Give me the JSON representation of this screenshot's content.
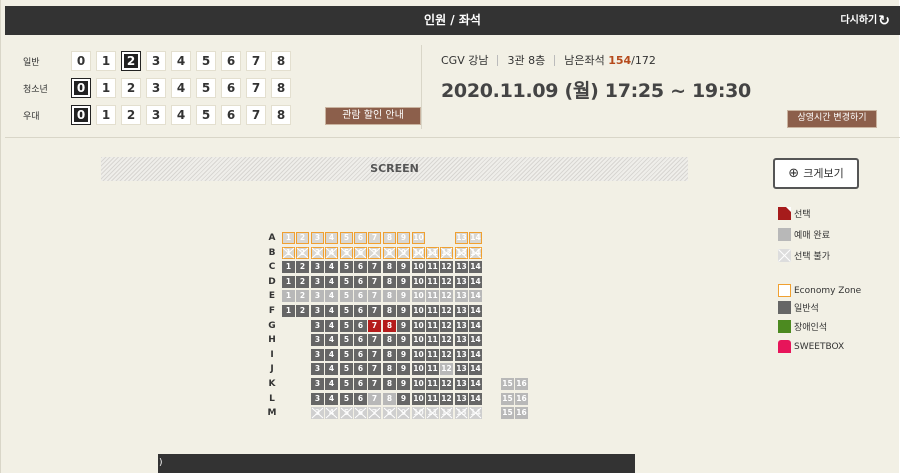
{
  "header": {
    "title": "인원 / 좌석",
    "refresh_label": "다시하기",
    "refresh_icon": "refresh-icon"
  },
  "counts": {
    "rows": [
      {
        "label": "일반",
        "selected": 2
      },
      {
        "label": "청소년",
        "selected": 0
      },
      {
        "label": "우대",
        "selected": 0
      }
    ],
    "numbers": [
      "0",
      "1",
      "2",
      "3",
      "4",
      "5",
      "6",
      "7",
      "8"
    ],
    "discount_label": "관람 할인 안내"
  },
  "theater": {
    "name": "CGV 강남",
    "hall": "3관 8층",
    "remaining_label": "남은좌석",
    "remaining": "154",
    "total": "/172",
    "datetime": "2020.11.09 (월) 17:25 ~ 19:30",
    "change_time_label": "상영시간 변경하기"
  },
  "screen_label": "SCREEN",
  "zoom_label": "크게보기",
  "legend": [
    {
      "key": "sel",
      "label": "선택"
    },
    {
      "key": "done",
      "label": "예매 완료"
    },
    {
      "key": "na",
      "label": "선택 불가"
    },
    {
      "key": "eco",
      "label": "Economy Zone"
    },
    {
      "key": "gen",
      "label": "일반석"
    },
    {
      "key": "dis",
      "label": "장애인석"
    },
    {
      "key": "sweet",
      "label": "SWEETBOX"
    }
  ],
  "colors": {
    "header": "#333333",
    "accent_button": "#8c5f4b",
    "selected_seat": "#b51c1c",
    "general_seat": "#666666",
    "economy_border": "#f0a030",
    "disabled_seat": "#4c8a20",
    "sweetbox": "#e7155a",
    "remaining_count": "#b54a1c"
  },
  "seats": {
    "rows": [
      {
        "label": "A",
        "seats": [
          [
            "1",
            "eco"
          ],
          [
            "2",
            "eco"
          ],
          [
            "3",
            "eco"
          ],
          [
            "4",
            "eco"
          ],
          [
            "5",
            "eco"
          ],
          [
            "6",
            "eco"
          ],
          [
            "7",
            "eco"
          ],
          [
            "8",
            "eco"
          ],
          [
            "9",
            "eco"
          ],
          [
            "10",
            "eco"
          ],
          null,
          null,
          [
            "13",
            "eco"
          ],
          [
            "14",
            "eco"
          ]
        ]
      },
      {
        "label": "B",
        "seats": [
          [
            "1",
            "ecox"
          ],
          [
            "2",
            "ecox"
          ],
          [
            "3",
            "ecox"
          ],
          [
            "4",
            "ecox"
          ],
          [
            "5",
            "ecox"
          ],
          [
            "6",
            "ecox"
          ],
          [
            "7",
            "ecox"
          ],
          [
            "8",
            "ecox"
          ],
          [
            "9",
            "ecox"
          ],
          [
            "10",
            "ecox"
          ],
          [
            "11",
            "ecox"
          ],
          [
            "12",
            "ecox"
          ],
          [
            "13",
            "ecox"
          ],
          [
            "14",
            "ecox"
          ]
        ]
      },
      {
        "label": "C",
        "seats": [
          [
            "1",
            "gen"
          ],
          [
            "2",
            "gen"
          ],
          [
            "3",
            "gen"
          ],
          [
            "4",
            "gen"
          ],
          [
            "5",
            "gen"
          ],
          [
            "6",
            "gen"
          ],
          [
            "7",
            "gen"
          ],
          [
            "8",
            "gen"
          ],
          [
            "9",
            "gen"
          ],
          [
            "10",
            "gen"
          ],
          [
            "11",
            "gen"
          ],
          [
            "12",
            "gen"
          ],
          [
            "13",
            "gen"
          ],
          [
            "14",
            "gen"
          ]
        ]
      },
      {
        "label": "D",
        "seats": [
          [
            "1",
            "gen"
          ],
          [
            "2",
            "gen"
          ],
          [
            "3",
            "gen"
          ],
          [
            "4",
            "gen"
          ],
          [
            "5",
            "gen"
          ],
          [
            "6",
            "gen"
          ],
          [
            "7",
            "gen"
          ],
          [
            "8",
            "gen"
          ],
          [
            "9",
            "gen"
          ],
          [
            "10",
            "gen"
          ],
          [
            "11",
            "gen"
          ],
          [
            "12",
            "gen"
          ],
          [
            "13",
            "gen"
          ],
          [
            "14",
            "gen"
          ]
        ]
      },
      {
        "label": "E",
        "seats": [
          [
            "1",
            "done"
          ],
          [
            "2",
            "done"
          ],
          [
            "3",
            "done"
          ],
          [
            "4",
            "done"
          ],
          [
            "5",
            "done"
          ],
          [
            "6",
            "done"
          ],
          [
            "7",
            "done"
          ],
          [
            "8",
            "done"
          ],
          [
            "9",
            "done"
          ],
          [
            "10",
            "done"
          ],
          [
            "11",
            "done"
          ],
          [
            "12",
            "done"
          ],
          [
            "13",
            "done"
          ],
          [
            "14",
            "done"
          ]
        ]
      },
      {
        "label": "F",
        "seats": [
          [
            "1",
            "gen"
          ],
          [
            "2",
            "gen"
          ],
          [
            "3",
            "gen"
          ],
          [
            "4",
            "gen"
          ],
          [
            "5",
            "gen"
          ],
          [
            "6",
            "gen"
          ],
          [
            "7",
            "gen"
          ],
          [
            "8",
            "gen"
          ],
          [
            "9",
            "gen"
          ],
          [
            "10",
            "gen"
          ],
          [
            "11",
            "gen"
          ],
          [
            "12",
            "gen"
          ],
          [
            "13",
            "gen"
          ],
          [
            "14",
            "gen"
          ]
        ]
      },
      {
        "label": "G",
        "seats": [
          null,
          null,
          [
            "3",
            "gen"
          ],
          [
            "4",
            "gen"
          ],
          [
            "5",
            "gen"
          ],
          [
            "6",
            "gen"
          ],
          [
            "7",
            "sel"
          ],
          [
            "8",
            "sel"
          ],
          [
            "9",
            "gen"
          ],
          [
            "10",
            "gen"
          ],
          [
            "11",
            "gen"
          ],
          [
            "12",
            "gen"
          ],
          [
            "13",
            "gen"
          ],
          [
            "14",
            "gen"
          ]
        ]
      },
      {
        "label": "H",
        "seats": [
          null,
          null,
          [
            "3",
            "gen"
          ],
          [
            "4",
            "gen"
          ],
          [
            "5",
            "gen"
          ],
          [
            "6",
            "gen"
          ],
          [
            "7",
            "gen"
          ],
          [
            "8",
            "gen"
          ],
          [
            "9",
            "gen"
          ],
          [
            "10",
            "gen"
          ],
          [
            "11",
            "gen"
          ],
          [
            "12",
            "gen"
          ],
          [
            "13",
            "gen"
          ],
          [
            "14",
            "gen"
          ]
        ]
      },
      {
        "label": "I",
        "seats": [
          null,
          null,
          [
            "3",
            "gen"
          ],
          [
            "4",
            "gen"
          ],
          [
            "5",
            "gen"
          ],
          [
            "6",
            "gen"
          ],
          [
            "7",
            "gen"
          ],
          [
            "8",
            "gen"
          ],
          [
            "9",
            "gen"
          ],
          [
            "10",
            "gen"
          ],
          [
            "11",
            "gen"
          ],
          [
            "12",
            "gen"
          ],
          [
            "13",
            "gen"
          ],
          [
            "14",
            "gen"
          ]
        ]
      },
      {
        "label": "J",
        "seats": [
          null,
          null,
          [
            "3",
            "gen"
          ],
          [
            "4",
            "gen"
          ],
          [
            "5",
            "gen"
          ],
          [
            "6",
            "gen"
          ],
          [
            "7",
            "gen"
          ],
          [
            "8",
            "gen"
          ],
          [
            "9",
            "gen"
          ],
          [
            "10",
            "gen"
          ],
          [
            "11",
            "gen"
          ],
          [
            "12",
            "done"
          ],
          [
            "13",
            "gen"
          ],
          [
            "14",
            "gen"
          ]
        ]
      },
      {
        "label": "K",
        "seats": [
          null,
          null,
          [
            "3",
            "gen"
          ],
          [
            "4",
            "gen"
          ],
          [
            "5",
            "gen"
          ],
          [
            "6",
            "gen"
          ],
          [
            "7",
            "gen"
          ],
          [
            "8",
            "gen"
          ],
          [
            "9",
            "gen"
          ],
          [
            "10",
            "gen"
          ],
          [
            "11",
            "gen"
          ],
          [
            "12",
            "gen"
          ],
          [
            "13",
            "gen"
          ],
          [
            "14",
            "gen"
          ],
          null,
          [
            "15",
            "done"
          ],
          [
            "16",
            "done"
          ]
        ]
      },
      {
        "label": "L",
        "seats": [
          null,
          null,
          [
            "3",
            "gen"
          ],
          [
            "4",
            "gen"
          ],
          [
            "5",
            "gen"
          ],
          [
            "6",
            "gen"
          ],
          [
            "7",
            "done"
          ],
          [
            "8",
            "done"
          ],
          [
            "9",
            "gen"
          ],
          [
            "10",
            "gen"
          ],
          [
            "11",
            "gen"
          ],
          [
            "12",
            "gen"
          ],
          [
            "13",
            "gen"
          ],
          [
            "14",
            "gen"
          ],
          null,
          [
            "15",
            "done"
          ],
          [
            "16",
            "done"
          ]
        ]
      },
      {
        "label": "M",
        "seats": [
          null,
          null,
          [
            "3",
            "nax"
          ],
          [
            "4",
            "nax"
          ],
          [
            "5",
            "nax"
          ],
          [
            "6",
            "nax"
          ],
          [
            "7",
            "nax"
          ],
          [
            "8",
            "nax"
          ],
          [
            "9",
            "nax"
          ],
          [
            "10",
            "nax"
          ],
          [
            "11",
            "nax"
          ],
          [
            "12",
            "nax"
          ],
          [
            "13",
            "nax"
          ],
          [
            "14",
            "nax"
          ],
          null,
          [
            "15",
            "done"
          ],
          [
            "16",
            "done"
          ]
        ]
      }
    ]
  },
  "bottom_bar_text": ")"
}
